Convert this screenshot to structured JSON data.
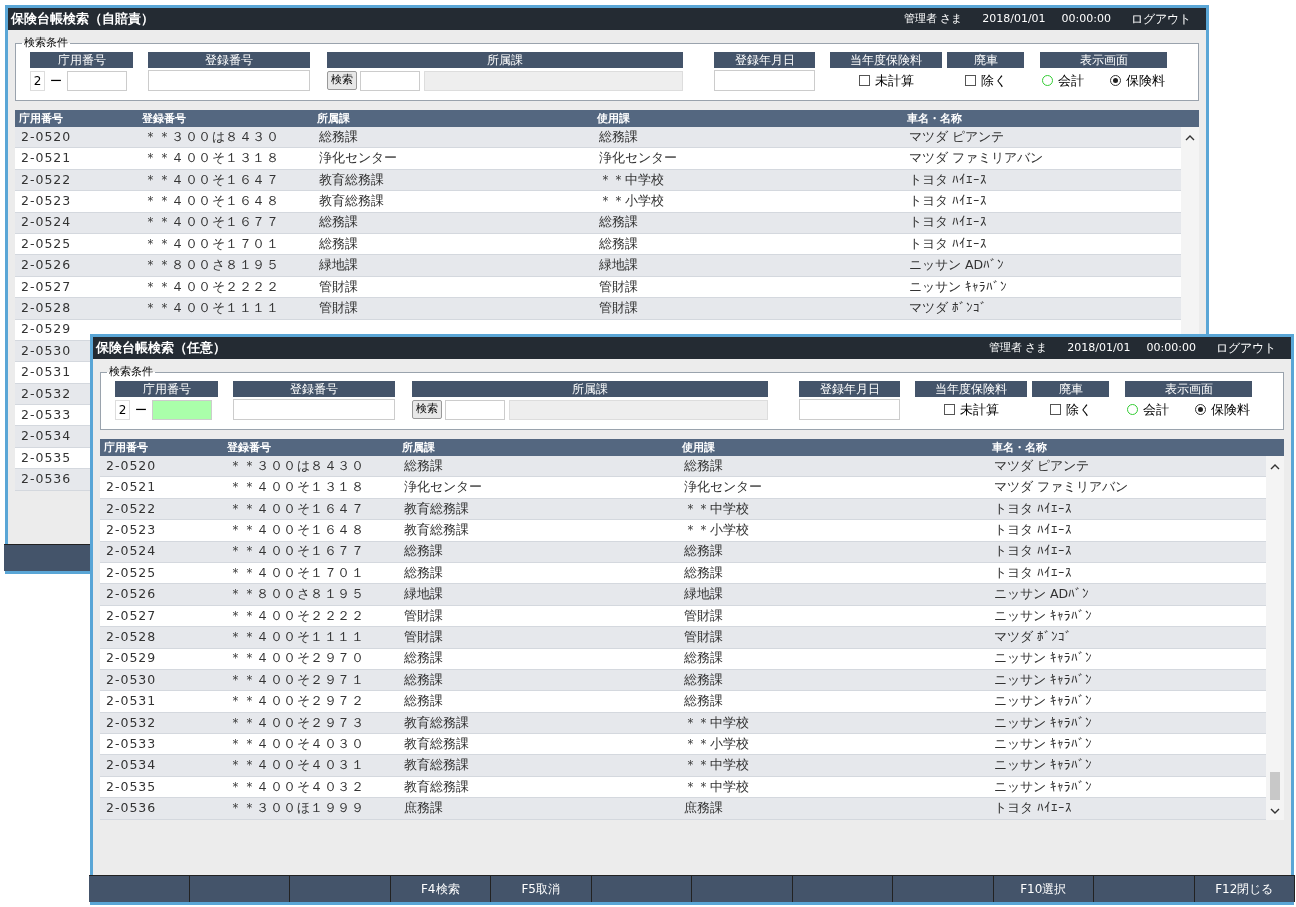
{
  "windows": [
    {
      "title": "保険台帳検索（自賠責）",
      "user": "管理者 さま",
      "date": "2018/01/01",
      "time": "00:00:00",
      "logout": "ログアウト",
      "search": {
        "legend": "検索条件",
        "fields": [
          {
            "kind": "number",
            "label": "庁用番号",
            "prefix": "2",
            "dash": "ー",
            "active": false
          },
          {
            "kind": "text",
            "label": "登録番号"
          },
          {
            "kind": "dept",
            "label": "所属課",
            "button": "検索"
          },
          {
            "kind": "date",
            "label": "登録年月日"
          },
          {
            "kind": "check",
            "label": "当年度保険料",
            "option": "未計算",
            "checked": false
          },
          {
            "kind": "check",
            "label": "廃車",
            "option": "除く",
            "checked": false
          },
          {
            "kind": "radio",
            "label": "表示画面",
            "options": [
              {
                "label": "会計",
                "selected": false
              },
              {
                "label": "保険料",
                "selected": true
              }
            ]
          }
        ]
      },
      "columns": [
        "庁用番号",
        "登録番号",
        "所属課",
        "使用課",
        "車名・名称"
      ],
      "rows": [
        {
          "cells": [
            "2-0520",
            "＊＊３００は８４３０",
            "総務課",
            "総務課",
            "マツダ ピアンテ"
          ]
        },
        {
          "cells": [
            "2-0521",
            "＊＊４００そ１３１８",
            "浄化センター",
            "浄化センター",
            "マツダ ファミリアバン"
          ]
        },
        {
          "cells": [
            "2-0522",
            "＊＊４００そ１６４７",
            "教育総務課",
            "＊＊中学校",
            "トヨタ ﾊｲｴｰｽ"
          ]
        },
        {
          "cells": [
            "2-0523",
            "＊＊４００そ１６４８",
            "教育総務課",
            "＊＊小学校",
            "トヨタ ﾊｲｴｰｽ"
          ]
        },
        {
          "cells": [
            "2-0524",
            "＊＊４００そ１６７７",
            "総務課",
            "総務課",
            "トヨタ ﾊｲｴｰｽ"
          ]
        },
        {
          "cells": [
            "2-0525",
            "＊＊４００そ１７０１",
            "総務課",
            "総務課",
            "トヨタ ﾊｲｴｰｽ"
          ]
        },
        {
          "cells": [
            "2-0526",
            "＊＊８００さ８１９５",
            "緑地課",
            "緑地課",
            "ニッサン ADﾊﾞﾝ"
          ]
        },
        {
          "cells": [
            "2-0527",
            "＊＊４００そ２２２２",
            "管財課",
            "管財課",
            "ニッサン ｷｬﾗﾊﾞﾝ"
          ]
        },
        {
          "cells": [
            "2-0528",
            "＊＊４００そ１１１１",
            "管財課",
            "管財課",
            "マツダ ﾎﾞﾝｺﾞ"
          ]
        },
        {
          "cells": [
            "2-0529"
          ]
        },
        {
          "cells": [
            "2-0530"
          ]
        },
        {
          "cells": [
            "2-0531"
          ]
        },
        {
          "cells": [
            "2-0532"
          ]
        },
        {
          "cells": [
            "2-0533"
          ]
        },
        {
          "cells": [
            "2-0534"
          ]
        },
        {
          "cells": [
            "2-0535"
          ]
        },
        {
          "cells": [
            "2-0536"
          ]
        }
      ]
    },
    {
      "title": "保険台帳検索（任意）",
      "user": "管理者 さま",
      "date": "2018/01/01",
      "time": "00:00:00",
      "logout": "ログアウト",
      "search": {
        "legend": "検索条件",
        "fields": [
          {
            "kind": "number",
            "label": "庁用番号",
            "prefix": "2",
            "dash": "ー",
            "active": true
          },
          {
            "kind": "text",
            "label": "登録番号"
          },
          {
            "kind": "dept",
            "label": "所属課",
            "button": "検索"
          },
          {
            "kind": "date",
            "label": "登録年月日"
          },
          {
            "kind": "check",
            "label": "当年度保険料",
            "option": "未計算",
            "checked": false
          },
          {
            "kind": "check",
            "label": "廃車",
            "option": "除く",
            "checked": false
          },
          {
            "kind": "radio",
            "label": "表示画面",
            "options": [
              {
                "label": "会計",
                "selected": false
              },
              {
                "label": "保険料",
                "selected": true
              }
            ]
          }
        ]
      },
      "columns": [
        "庁用番号",
        "登録番号",
        "所属課",
        "使用課",
        "車名・名称"
      ],
      "rows": [
        {
          "cells": [
            "2-0520",
            "＊＊３００は８４３０",
            "総務課",
            "総務課",
            "マツダ ピアンテ"
          ]
        },
        {
          "cells": [
            "2-0521",
            "＊＊４００そ１３１８",
            "浄化センター",
            "浄化センター",
            "マツダ ファミリアバン"
          ]
        },
        {
          "cells": [
            "2-0522",
            "＊＊４００そ１６４７",
            "教育総務課",
            "＊＊中学校",
            "トヨタ ﾊｲｴｰｽ"
          ]
        },
        {
          "cells": [
            "2-0523",
            "＊＊４００そ１６４８",
            "教育総務課",
            "＊＊小学校",
            "トヨタ ﾊｲｴｰｽ"
          ]
        },
        {
          "cells": [
            "2-0524",
            "＊＊４００そ１６７７",
            "総務課",
            "総務課",
            "トヨタ ﾊｲｴｰｽ"
          ]
        },
        {
          "cells": [
            "2-0525",
            "＊＊４００そ１７０１",
            "総務課",
            "総務課",
            "トヨタ ﾊｲｴｰｽ"
          ]
        },
        {
          "cells": [
            "2-0526",
            "＊＊８００さ８１９５",
            "緑地課",
            "緑地課",
            "ニッサン ADﾊﾞﾝ"
          ]
        },
        {
          "cells": [
            "2-0527",
            "＊＊４００そ２２２２",
            "管財課",
            "管財課",
            "ニッサン ｷｬﾗﾊﾞﾝ"
          ]
        },
        {
          "cells": [
            "2-0528",
            "＊＊４００そ１１１１",
            "管財課",
            "管財課",
            "マツダ ﾎﾞﾝｺﾞ"
          ]
        },
        {
          "cells": [
            "2-0529",
            "＊＊４００そ２９７０",
            "総務課",
            "総務課",
            "ニッサン ｷｬﾗﾊﾞﾝ"
          ]
        },
        {
          "cells": [
            "2-0530",
            "＊＊４００そ２９７１",
            "総務課",
            "総務課",
            "ニッサン ｷｬﾗﾊﾞﾝ"
          ]
        },
        {
          "cells": [
            "2-0531",
            "＊＊４００そ２９７２",
            "総務課",
            "総務課",
            "ニッサン ｷｬﾗﾊﾞﾝ"
          ]
        },
        {
          "cells": [
            "2-0532",
            "＊＊４００そ２９７３",
            "教育総務課",
            "＊＊中学校",
            "ニッサン ｷｬﾗﾊﾞﾝ"
          ]
        },
        {
          "cells": [
            "2-0533",
            "＊＊４００そ４０３０",
            "教育総務課",
            "＊＊小学校",
            "ニッサン ｷｬﾗﾊﾞﾝ"
          ]
        },
        {
          "cells": [
            "2-0534",
            "＊＊４００そ４０３１",
            "教育総務課",
            "＊＊中学校",
            "ニッサン ｷｬﾗﾊﾞﾝ"
          ]
        },
        {
          "cells": [
            "2-0535",
            "＊＊４００そ４０３２",
            "教育総務課",
            "＊＊中学校",
            "ニッサン ｷｬﾗﾊﾞﾝ"
          ]
        },
        {
          "cells": [
            "2-0536",
            "＊＊３００ほ１９９９",
            "庶務課",
            "庶務課",
            "トヨタ ﾊｲｴｰｽ"
          ]
        }
      ],
      "function_keys": [
        {
          "key": "F4",
          "label": "検索"
        },
        {
          "key": "F5",
          "label": "取消"
        },
        {
          "key": "F10",
          "label": "選択"
        },
        {
          "key": "F12",
          "label": "閉じる"
        }
      ]
    }
  ]
}
